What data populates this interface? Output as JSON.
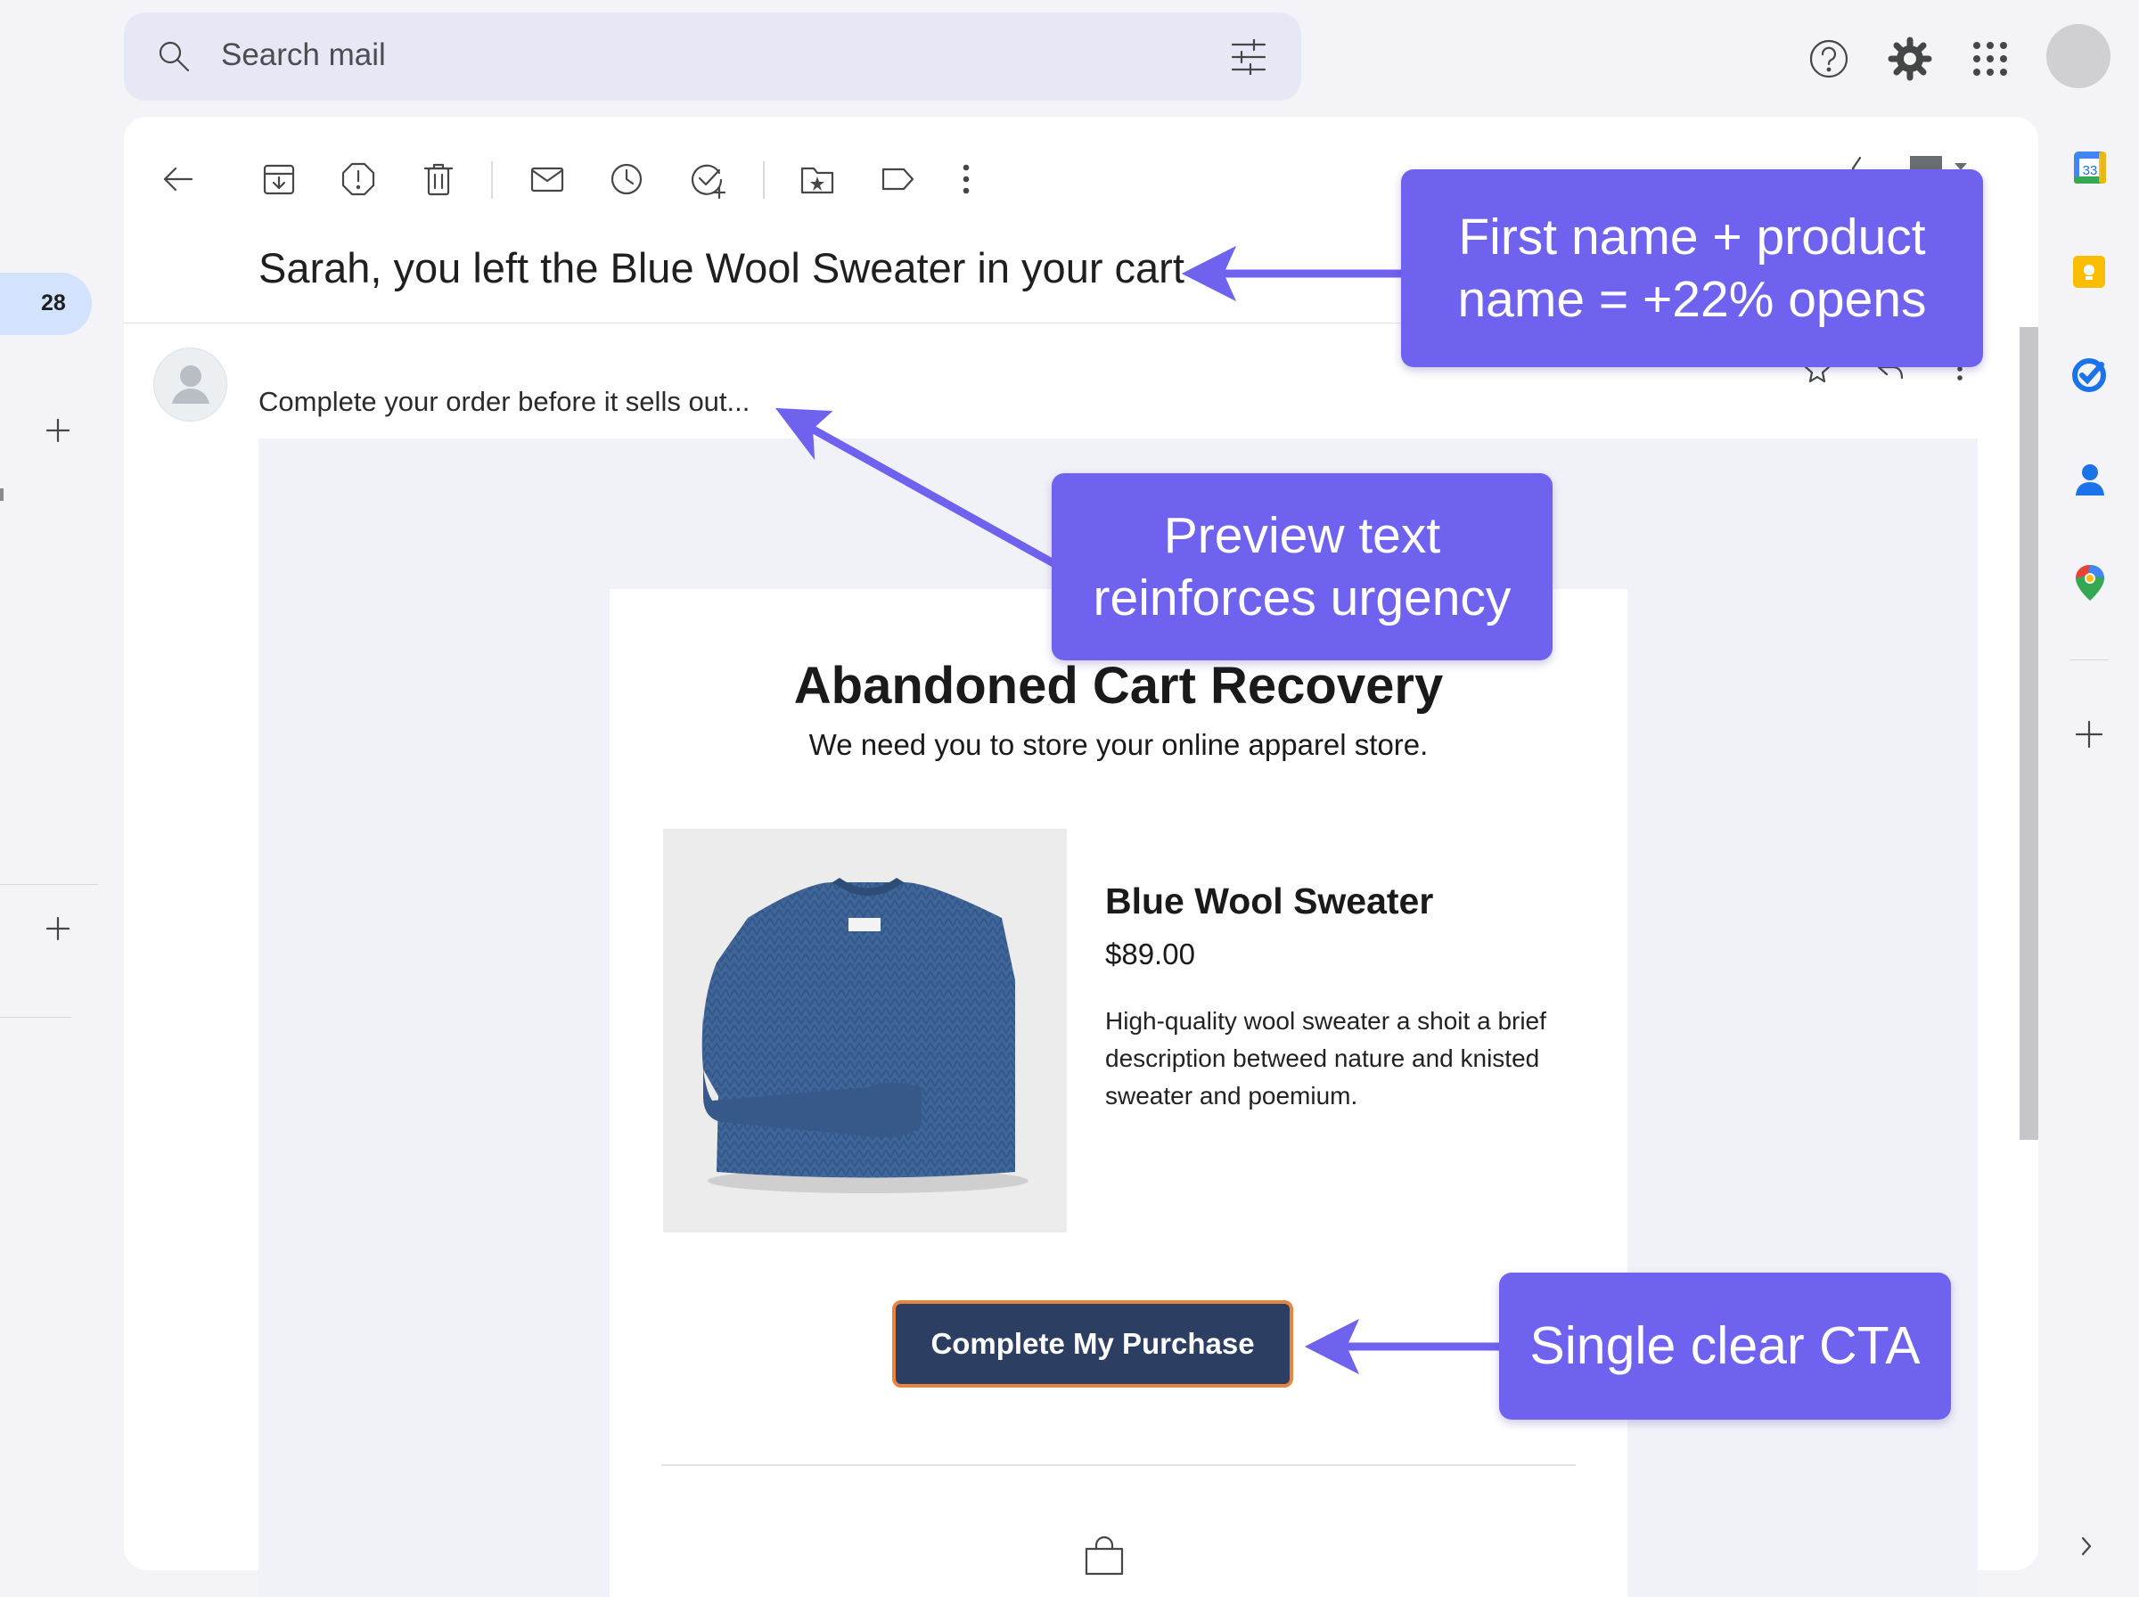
{
  "search": {
    "placeholder": "Search mail",
    "icon": "search-icon",
    "filter_icon": "tune-icon"
  },
  "header_icons": [
    "help-icon",
    "settings-gear-icon",
    "apps-grid-icon",
    "account-avatar"
  ],
  "left_rail": {
    "badge_count": "28",
    "add_icons": [
      "plus-icon",
      "plus-icon"
    ]
  },
  "toolbar": {
    "icons": [
      "back-arrow-icon",
      "archive-icon",
      "report-spam-icon",
      "delete-icon",
      "mark-unread-icon",
      "snooze-icon",
      "add-task-icon",
      "move-to-icon",
      "label-icon",
      "more-vert-icon"
    ]
  },
  "message": {
    "subject": "Sarah, you left the Blue Wool Sweater in your cart",
    "preview": "Complete your order before it sells out...",
    "actions": [
      "star-icon",
      "reply-icon",
      "more-vert-icon"
    ]
  },
  "email": {
    "title": "Abandoned Cart Recovery",
    "subtitle": "We need you to store your online apparel store.",
    "product": {
      "name": "Blue Wool Sweater",
      "price": "$89.00",
      "description": "High-quality wool sweater a shoit a brief description betweed nature and knisted sweater and poemium.",
      "image": "blue-knit-sweater"
    },
    "cta_label": "Complete My Purchase",
    "footer_icon": "shopping-bag-icon"
  },
  "annotations": {
    "subject_note": [
      "First name + product",
      "name = +22% opens"
    ],
    "preview_note": [
      "Preview text",
      "reinforces urgency"
    ],
    "cta_note": "Single clear CTA"
  },
  "side_panel": {
    "calendar_date": "33",
    "apps": [
      "calendar-icon",
      "keep-icon",
      "tasks-icon",
      "contacts-icon",
      "maps-icon",
      "plus-icon",
      "chevron-right-icon"
    ]
  },
  "colors": {
    "callout": "#6f62ef",
    "cta_bg": "#2c3e62",
    "cta_border": "#e7843f",
    "search_bg": "#e6e9f5"
  }
}
